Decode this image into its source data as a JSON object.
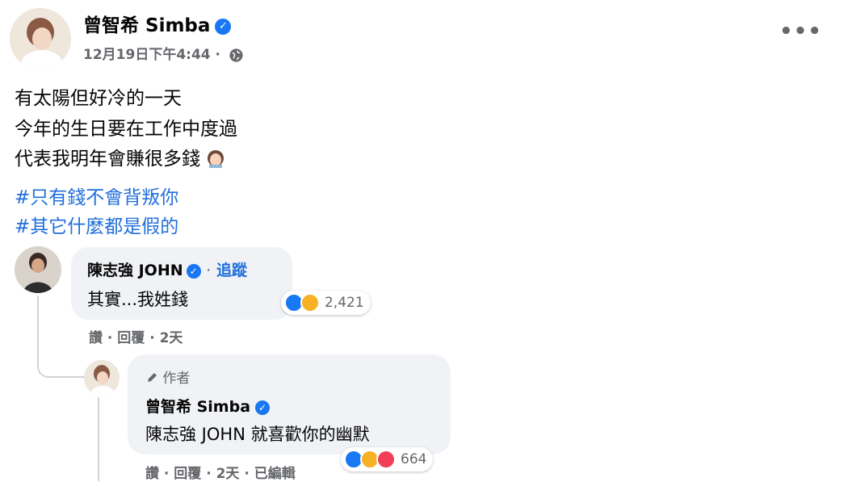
{
  "post": {
    "author": "曾智希 Simba",
    "timestamp": "12月19日下午4:44",
    "separator": "·",
    "more": "•••",
    "lines": [
      "有太陽但好冷的一天",
      "今年的生日要在工作中度過",
      "代表我明年會賺很多錢"
    ],
    "hashtags": [
      "#只有錢不會背叛你",
      "#其它什麼都是假的"
    ],
    "icons": {
      "verified": "verified-check-icon",
      "audience": "globe-icon",
      "emoji": "woman-face-emoji"
    }
  },
  "comment1": {
    "author": "陳志強 JOHN",
    "dot": "·",
    "follow": "追蹤",
    "text": "其實...我姓錢",
    "reaction_count": "2,421",
    "actions": "讚 · 回覆 · 2天"
  },
  "reply": {
    "badge": "作者",
    "author": "曾智希 Simba",
    "text": "陳志強 JOHN 就喜歡你的幽默",
    "reaction_count": "664",
    "actions": "讚 · 回覆 · 2天 · 已編輯"
  },
  "colors": {
    "link": "#216fdb",
    "verified": "#1877f2",
    "bubble": "#f0f2f5",
    "meta": "#65676b"
  }
}
